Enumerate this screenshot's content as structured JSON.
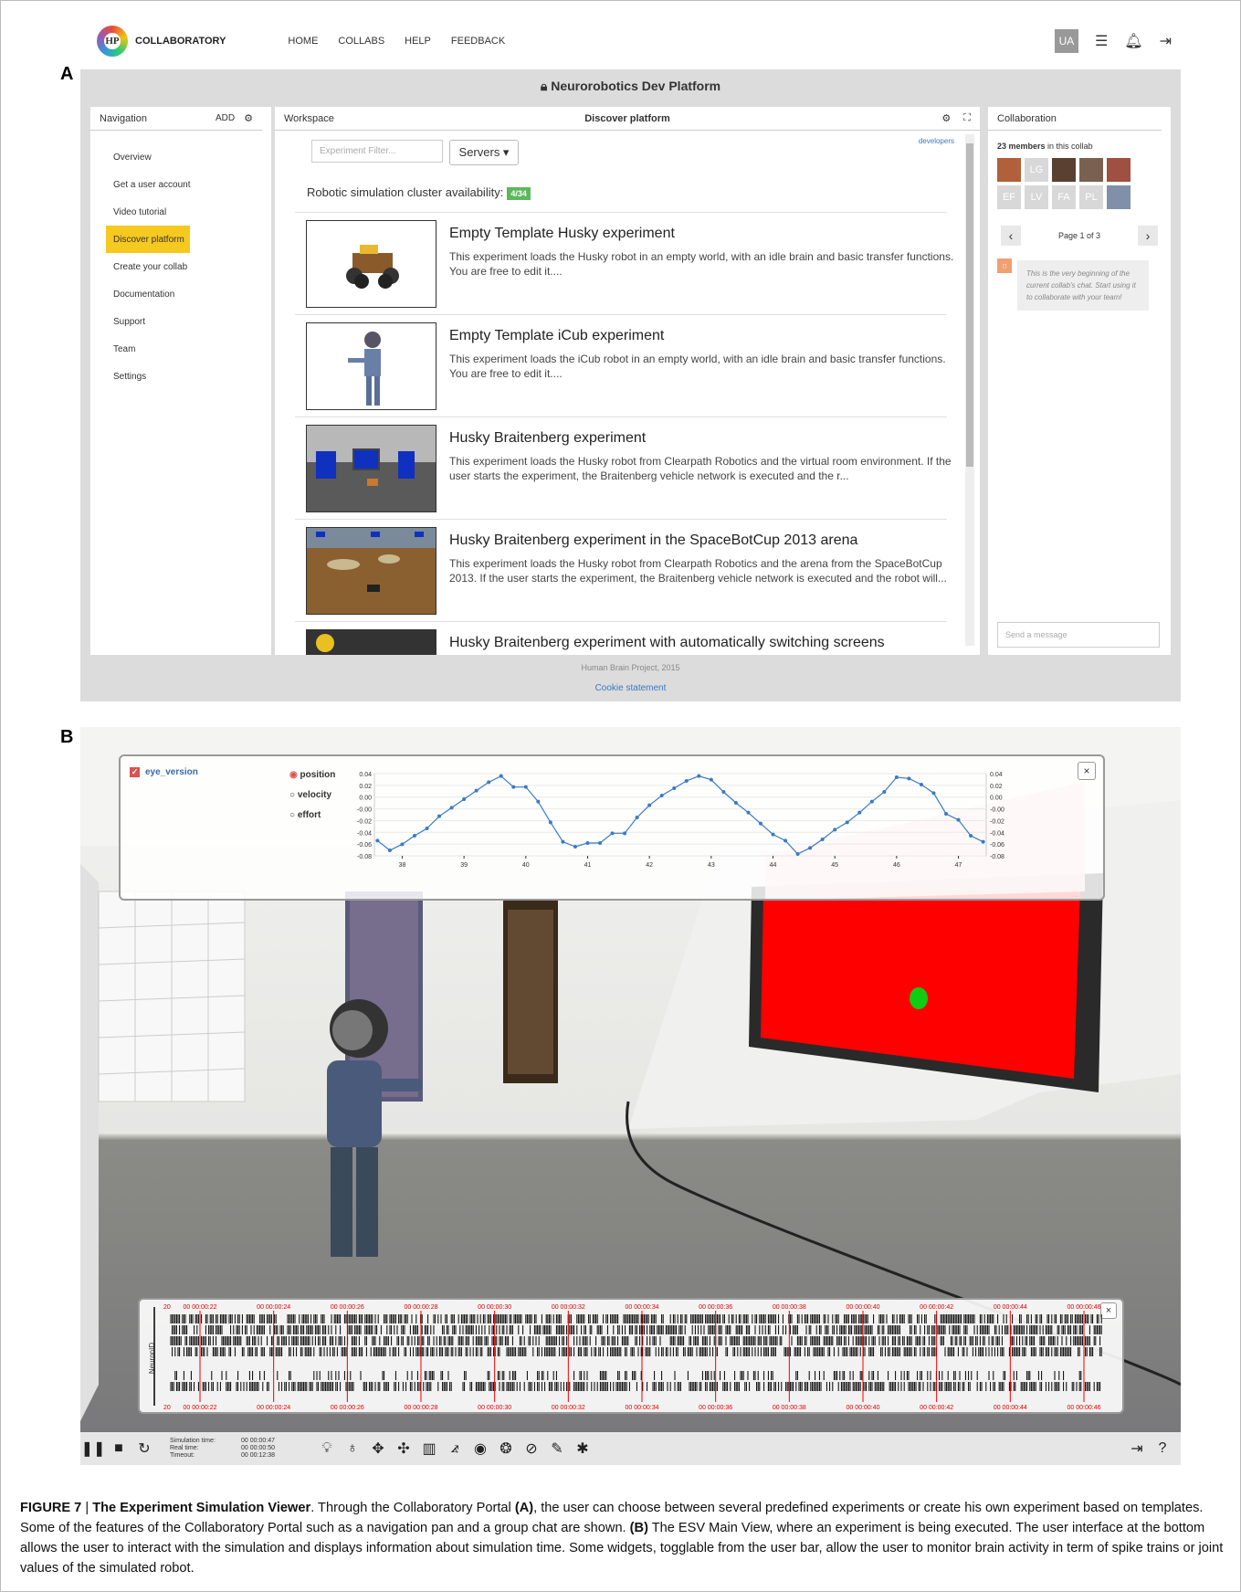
{
  "panel_labels": {
    "a": "A",
    "b": "B"
  },
  "topbar": {
    "logo_text": "HP",
    "brand": "COLLABORATORY",
    "nav": [
      "HOME",
      "COLLABS",
      "HELP",
      "FEEDBACK"
    ],
    "user_initials": "UA",
    "icons": [
      "list-icon",
      "bell-icon",
      "logout-icon"
    ]
  },
  "platform_title": "Neurorobotics Dev Platform",
  "navigation": {
    "title": "Navigation",
    "add_label": "ADD",
    "items": [
      "Overview",
      "Get a user account",
      "Video tutorial",
      "Discover platform",
      "Create your collab",
      "Documentation",
      "Support",
      "Team",
      "Settings"
    ],
    "active": "Discover platform"
  },
  "workspace": {
    "title": "Workspace",
    "tab_title": "Discover platform",
    "filter_placeholder": "Experiment Filter...",
    "servers_label": "Servers ▾",
    "developers_link": "developers",
    "cluster_text": "Robotic simulation cluster availability:",
    "cluster_badge": "4/34",
    "experiments": [
      {
        "title": "Empty Template Husky experiment",
        "desc": "This experiment loads the Husky robot in an empty world, with an idle brain and basic transfer functions. You are free to edit it...."
      },
      {
        "title": "Empty Template iCub experiment",
        "desc": "This experiment loads the iCub robot in an empty world, with an idle brain and basic transfer functions. You are free to edit it...."
      },
      {
        "title": "Husky Braitenberg experiment",
        "desc": "This experiment loads the Husky robot from Clearpath Robotics and the virtual room environment. If the user starts the experiment, the Braitenberg vehicle network is executed and the r..."
      },
      {
        "title": "Husky Braitenberg experiment in the SpaceBotCup 2013 arena",
        "desc": "This experiment loads the Husky robot from Clearpath Robotics and the arena from the SpaceBotCup 2013. If the user starts the experiment, the Braitenberg vehicle network is executed and the robot will..."
      },
      {
        "title": "Husky Braitenberg experiment with automatically switching screens",
        "desc": ""
      }
    ]
  },
  "footer": {
    "copyright": "Human Brain Project, 2015",
    "cookie": "Cookie statement"
  },
  "collaboration": {
    "title": "Collaboration",
    "members_count": "23 members",
    "members_suffix": " in this collab",
    "avatars": [
      {
        "initials": "",
        "color": "#b0603a"
      },
      {
        "initials": "LG",
        "color": "#d8d8d8"
      },
      {
        "initials": "",
        "color": "#5a4030"
      },
      {
        "initials": "",
        "color": "#7a6050"
      },
      {
        "initials": "",
        "color": "#a05040"
      },
      {
        "initials": "EF",
        "color": "#d8d8d8"
      },
      {
        "initials": "LV",
        "color": "#d8d8d8"
      },
      {
        "initials": "FA",
        "color": "#d8d8d8"
      },
      {
        "initials": "PL",
        "color": "#d8d8d8"
      },
      {
        "initials": "",
        "color": "#8090a8"
      }
    ],
    "page_text": "Page 1 of 3",
    "chat_text": "This is the very beginning of the current collab's chat. Start using it to collaborate with your team!",
    "send_placeholder": "Send a message"
  },
  "joint_widget": {
    "checkbox_label": "eye_version",
    "radios": [
      "position",
      "velocity",
      "effort"
    ],
    "selected": "position",
    "close": "×"
  },
  "chart_data": {
    "type": "line",
    "x": [
      37.6,
      37.8,
      38.0,
      38.2,
      38.4,
      38.6,
      38.8,
      39.0,
      39.2,
      39.4,
      39.6,
      39.8,
      40.0,
      40.2,
      40.4,
      40.6,
      40.8,
      41.0,
      41.2,
      41.4,
      41.6,
      41.8,
      42.0,
      42.2,
      42.4,
      42.6,
      42.8,
      43.0,
      43.2,
      43.4,
      43.6,
      43.8,
      44.0,
      44.2,
      44.4,
      44.6,
      44.8,
      45.0,
      45.2,
      45.4,
      45.6,
      45.8,
      46.0,
      46.2,
      46.4,
      46.6,
      46.8,
      47.0,
      47.2,
      47.4
    ],
    "y": [
      -0.06,
      -0.076,
      -0.066,
      -0.052,
      -0.04,
      -0.02,
      -0.006,
      0.008,
      0.022,
      0.036,
      0.046,
      0.028,
      0.028,
      0.004,
      -0.03,
      -0.062,
      -0.07,
      -0.064,
      -0.064,
      -0.048,
      -0.048,
      -0.022,
      -0.002,
      0.014,
      0.026,
      0.038,
      0.046,
      0.04,
      0.02,
      0.002,
      -0.014,
      -0.032,
      -0.05,
      -0.06,
      -0.082,
      -0.072,
      -0.058,
      -0.042,
      -0.03,
      -0.014,
      0.004,
      0.02,
      0.044,
      0.042,
      0.032,
      0.018,
      -0.016,
      -0.026,
      -0.052,
      -0.062
    ],
    "xticks": [
      "38",
      "39",
      "40",
      "41",
      "42",
      "43",
      "44",
      "45",
      "46",
      "47"
    ],
    "yticks": [
      "0.04",
      "0.02",
      "0.00",
      "-0.00",
      "-0.02",
      "-0.04",
      "-0.06",
      "-0.08"
    ],
    "ylim": [
      -0.085,
      0.05
    ],
    "xlim": [
      37.55,
      47.45
    ]
  },
  "spike_widget": {
    "axis_label": "NeuronID",
    "y_top": "20",
    "y_bottom": "20",
    "times": [
      "00 00:00:22",
      "00 00:00:24",
      "00 00:00:26",
      "00 00:00:28",
      "00 00:00:30",
      "00 00:00:32",
      "00 00:00:34",
      "00 00:00:36",
      "00 00:00:38",
      "00 00:00:40",
      "00 00:00:42",
      "00 00:00:44",
      "00 00:00:46"
    ],
    "close": "×"
  },
  "toolbar": {
    "sim_labels": [
      "Simulation time:",
      "Real time:",
      "Timeout:"
    ],
    "sim_values": [
      "00 00:00:47",
      "00 00:00:50",
      "00 00:12:38"
    ]
  },
  "caption": {
    "prefix": "FIGURE 7",
    "sep": " | ",
    "title": "The Experiment Simulation Viewer",
    "t1": ". Through the Collaboratory Portal ",
    "a": "(A)",
    "t2": ", the user can choose between several predefined experiments or create his own experiment based on templates. Some of the features of the Collaboratory Portal such as a navigation pan and a group chat are shown. ",
    "b": "(B)",
    "t3": " The ESV Main View, where an experiment is being executed. The user interface at the bottom allows the user to interact with the simulation and displays information about simulation time. Some widgets, togglable from the user bar, allow the user to monitor brain activity in term of spike trains or joint values of the simulated robot."
  }
}
